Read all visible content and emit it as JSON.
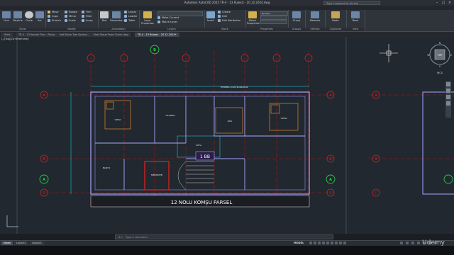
{
  "title_bar": {
    "title": "Autodesk AutoCAD 2015   TR-4 - 13 Rulesiz - 20.12.2024.dwg",
    "search_placeholder": "Type a keyword or phrase"
  },
  "menu_tabs": [
    "Home",
    "Insert",
    "Annotate",
    "Parametric",
    "View",
    "Manage",
    "Output",
    "Add-ins",
    "Autodesk 360",
    "Express Tools",
    "BIM 360",
    "Performance"
  ],
  "ribbon": {
    "draw": {
      "title": "Draw",
      "line": "Line",
      "polyline": "Polyline",
      "circle": "Circle",
      "arc": "Arc"
    },
    "modify": {
      "title": "Modify",
      "move": "Move",
      "rotate": "Rotate",
      "trim": "Trim",
      "copy": "Copy",
      "mirror": "Mirror",
      "fillet": "Fillet",
      "stretch": "Stretch",
      "scale": "Scale",
      "array": "Array"
    },
    "annotation": {
      "title": "Annotation",
      "text": "Text",
      "dimension": "Dimension",
      "linear": "Linear",
      "leader": "Leader",
      "table": "Table"
    },
    "layers": {
      "title": "Layers",
      "properties": "Layer Properties",
      "make_current": "Make Current",
      "match_layer": "Match Layer"
    },
    "block": {
      "title": "Block",
      "insert": "Insert",
      "create": "Create",
      "edit": "Edit",
      "edit_attributes": "Edit Attributes"
    },
    "properties": {
      "title": "Properties",
      "match": "Match Properties",
      "bylayer": "ByLayer"
    },
    "groups": {
      "title": "Groups",
      "group": "Group"
    },
    "utilities": {
      "title": "Utilities",
      "measure": "Measure"
    },
    "clipboard": {
      "title": "Clipboard",
      "paste": "Paste"
    },
    "view": {
      "title": "View",
      "base": "Base"
    }
  },
  "file_tabs": [
    "Start",
    "TR-4 - 13 Kontrol Plan - Rolue...",
    "Not Rolue Tam Kontrol...",
    "Nest Rolue Proje Cizimi.dwg",
    "TR-4 - 13 Rulesiz - 20.12.2024*"
  ],
  "active_file_tab": 4,
  "viewport_label": "[-][Top][2D Wireframe]",
  "drawing": {
    "axis_numbers": [
      "1",
      "2",
      "3",
      "4",
      "5",
      "6"
    ],
    "axis_letters": [
      "A",
      "B",
      "C"
    ],
    "axis_labels_top": [
      "B"
    ],
    "room_tag": "1 BB",
    "bottom_caption": "12 NOLU KOMŞU PARSEL",
    "top_note": "TEMPERLI CAM KORKULUK",
    "room_labels": [
      "YATAK",
      "OTURMA",
      "ODA",
      "YATAK",
      "SOFA",
      "BANYO",
      "MERDİVEN"
    ],
    "compass": {
      "north": "N",
      "south": "S",
      "east": "E",
      "west": "W",
      "center": "TOP",
      "ucs": "WCS"
    }
  },
  "command_line": {
    "placeholder": "Type a command"
  },
  "status_bar": {
    "layout_tabs": [
      "Model",
      "Layout1",
      "Layout2"
    ],
    "active_layout": 0,
    "model_label": "MODEL"
  },
  "watermark": "Udemy",
  "colors": {
    "drawing_bg": "#212830",
    "wall": "#a0a0ff",
    "cyan": "#26e0e8",
    "red_grid": "#d02020",
    "orange": "#e08a2a",
    "green": "#20d040"
  }
}
